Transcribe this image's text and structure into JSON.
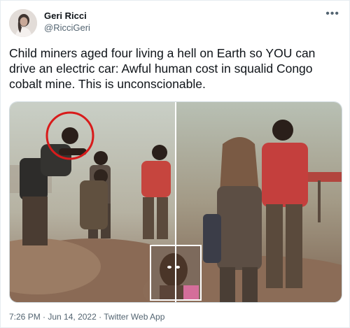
{
  "author": {
    "display_name": "Geri Ricci",
    "handle": "@RicciGeri",
    "avatar_icon": "profile-photo"
  },
  "tweet": {
    "text": "Child miners aged four living a hell on Earth so YOU can drive an electric car: Awful human cost in squalid Congo cobalt mine.  This is unconscionable.",
    "more_icon": "ellipsis-icon"
  },
  "meta": {
    "time": "7:26 PM",
    "separator": " · ",
    "date": "Jun 14, 2022",
    "source": "Twitter Web App"
  },
  "colors": {
    "accent_circle": "#d81b1b",
    "secondary_text": "#536471"
  }
}
